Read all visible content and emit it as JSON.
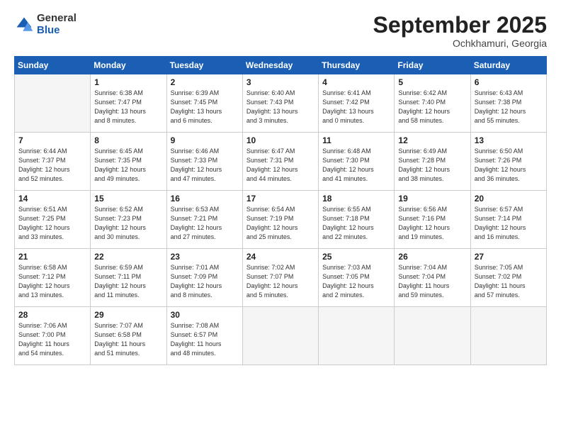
{
  "header": {
    "logo_general": "General",
    "logo_blue": "Blue",
    "month_title": "September 2025",
    "subtitle": "Ochkhamuri, Georgia"
  },
  "days_of_week": [
    "Sunday",
    "Monday",
    "Tuesday",
    "Wednesday",
    "Thursday",
    "Friday",
    "Saturday"
  ],
  "weeks": [
    [
      {
        "day": "",
        "detail": ""
      },
      {
        "day": "1",
        "detail": "Sunrise: 6:38 AM\nSunset: 7:47 PM\nDaylight: 13 hours\nand 8 minutes."
      },
      {
        "day": "2",
        "detail": "Sunrise: 6:39 AM\nSunset: 7:45 PM\nDaylight: 13 hours\nand 6 minutes."
      },
      {
        "day": "3",
        "detail": "Sunrise: 6:40 AM\nSunset: 7:43 PM\nDaylight: 13 hours\nand 3 minutes."
      },
      {
        "day": "4",
        "detail": "Sunrise: 6:41 AM\nSunset: 7:42 PM\nDaylight: 13 hours\nand 0 minutes."
      },
      {
        "day": "5",
        "detail": "Sunrise: 6:42 AM\nSunset: 7:40 PM\nDaylight: 12 hours\nand 58 minutes."
      },
      {
        "day": "6",
        "detail": "Sunrise: 6:43 AM\nSunset: 7:38 PM\nDaylight: 12 hours\nand 55 minutes."
      }
    ],
    [
      {
        "day": "7",
        "detail": "Sunrise: 6:44 AM\nSunset: 7:37 PM\nDaylight: 12 hours\nand 52 minutes."
      },
      {
        "day": "8",
        "detail": "Sunrise: 6:45 AM\nSunset: 7:35 PM\nDaylight: 12 hours\nand 49 minutes."
      },
      {
        "day": "9",
        "detail": "Sunrise: 6:46 AM\nSunset: 7:33 PM\nDaylight: 12 hours\nand 47 minutes."
      },
      {
        "day": "10",
        "detail": "Sunrise: 6:47 AM\nSunset: 7:31 PM\nDaylight: 12 hours\nand 44 minutes."
      },
      {
        "day": "11",
        "detail": "Sunrise: 6:48 AM\nSunset: 7:30 PM\nDaylight: 12 hours\nand 41 minutes."
      },
      {
        "day": "12",
        "detail": "Sunrise: 6:49 AM\nSunset: 7:28 PM\nDaylight: 12 hours\nand 38 minutes."
      },
      {
        "day": "13",
        "detail": "Sunrise: 6:50 AM\nSunset: 7:26 PM\nDaylight: 12 hours\nand 36 minutes."
      }
    ],
    [
      {
        "day": "14",
        "detail": "Sunrise: 6:51 AM\nSunset: 7:25 PM\nDaylight: 12 hours\nand 33 minutes."
      },
      {
        "day": "15",
        "detail": "Sunrise: 6:52 AM\nSunset: 7:23 PM\nDaylight: 12 hours\nand 30 minutes."
      },
      {
        "day": "16",
        "detail": "Sunrise: 6:53 AM\nSunset: 7:21 PM\nDaylight: 12 hours\nand 27 minutes."
      },
      {
        "day": "17",
        "detail": "Sunrise: 6:54 AM\nSunset: 7:19 PM\nDaylight: 12 hours\nand 25 minutes."
      },
      {
        "day": "18",
        "detail": "Sunrise: 6:55 AM\nSunset: 7:18 PM\nDaylight: 12 hours\nand 22 minutes."
      },
      {
        "day": "19",
        "detail": "Sunrise: 6:56 AM\nSunset: 7:16 PM\nDaylight: 12 hours\nand 19 minutes."
      },
      {
        "day": "20",
        "detail": "Sunrise: 6:57 AM\nSunset: 7:14 PM\nDaylight: 12 hours\nand 16 minutes."
      }
    ],
    [
      {
        "day": "21",
        "detail": "Sunrise: 6:58 AM\nSunset: 7:12 PM\nDaylight: 12 hours\nand 13 minutes."
      },
      {
        "day": "22",
        "detail": "Sunrise: 6:59 AM\nSunset: 7:11 PM\nDaylight: 12 hours\nand 11 minutes."
      },
      {
        "day": "23",
        "detail": "Sunrise: 7:01 AM\nSunset: 7:09 PM\nDaylight: 12 hours\nand 8 minutes."
      },
      {
        "day": "24",
        "detail": "Sunrise: 7:02 AM\nSunset: 7:07 PM\nDaylight: 12 hours\nand 5 minutes."
      },
      {
        "day": "25",
        "detail": "Sunrise: 7:03 AM\nSunset: 7:05 PM\nDaylight: 12 hours\nand 2 minutes."
      },
      {
        "day": "26",
        "detail": "Sunrise: 7:04 AM\nSunset: 7:04 PM\nDaylight: 11 hours\nand 59 minutes."
      },
      {
        "day": "27",
        "detail": "Sunrise: 7:05 AM\nSunset: 7:02 PM\nDaylight: 11 hours\nand 57 minutes."
      }
    ],
    [
      {
        "day": "28",
        "detail": "Sunrise: 7:06 AM\nSunset: 7:00 PM\nDaylight: 11 hours\nand 54 minutes."
      },
      {
        "day": "29",
        "detail": "Sunrise: 7:07 AM\nSunset: 6:58 PM\nDaylight: 11 hours\nand 51 minutes."
      },
      {
        "day": "30",
        "detail": "Sunrise: 7:08 AM\nSunset: 6:57 PM\nDaylight: 11 hours\nand 48 minutes."
      },
      {
        "day": "",
        "detail": ""
      },
      {
        "day": "",
        "detail": ""
      },
      {
        "day": "",
        "detail": ""
      },
      {
        "day": "",
        "detail": ""
      }
    ]
  ]
}
